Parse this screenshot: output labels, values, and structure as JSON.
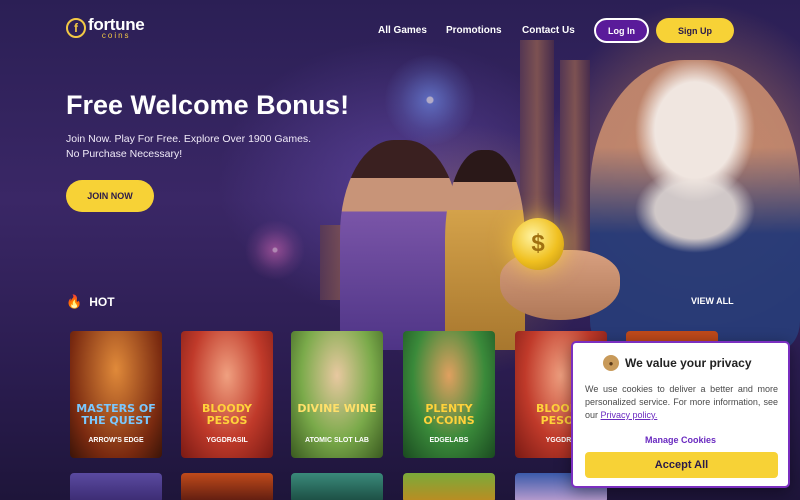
{
  "header": {
    "logo_main": "fortune",
    "logo_sub": "coins",
    "logo_glyph": "f",
    "nav": [
      "All Games",
      "Promotions",
      "Contact Us"
    ],
    "login_label": "Log In",
    "signup_label": "Sign Up"
  },
  "hero": {
    "title": "Free Welcome Bonus!",
    "subtitle_line1": "Join Now. Play For Free. Explore Over 1900 Games.",
    "subtitle_line2": "No Purchase Necessary!",
    "join_label": "JOIN NOW"
  },
  "hot": {
    "heading": "HOT",
    "view_all": "VIEW ALL",
    "games": [
      {
        "title": "MASTERS OF THE QUEST",
        "provider": "ARROW'S EDGE",
        "color": "#9a4a20"
      },
      {
        "title": "BLOODY PESOS",
        "provider": "YGGDRASIL",
        "color": "#c0342a"
      },
      {
        "title": "DIVINE WINE",
        "provider": "ATOMIC SLOT LAB",
        "color": "#6a9a3a"
      },
      {
        "title": "PLENTY O'COINS",
        "provider": "EDGELABS",
        "color": "#2a7a3a"
      },
      {
        "title": "BLOODY PESOS",
        "provider": "YGGDRA",
        "color": "#c0342a"
      }
    ]
  },
  "cookie": {
    "title": "We value your privacy",
    "text": "We use cookies to deliver a better and more personalized service. For more information, see our ",
    "link": "Privacy policy.",
    "manage": "Manage Cookies",
    "accept": "Accept All"
  },
  "icons": {
    "flame": "flame-icon",
    "cookie": "cookie-icon",
    "coin": "coin-icon"
  },
  "colors": {
    "accent_yellow": "#f7d236",
    "brand_purple": "#5a1b9a"
  }
}
